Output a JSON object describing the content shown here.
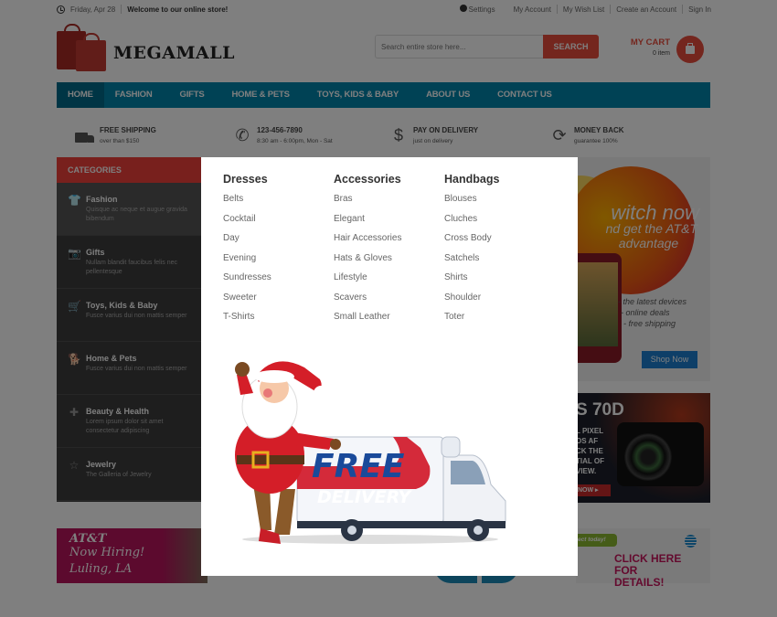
{
  "topbar": {
    "date": "Friday, Apr 28",
    "welcome": "Welcome to our online store!",
    "links": [
      "Settings",
      "My Account",
      "My Wish List",
      "Create an Account",
      "Sign In"
    ]
  },
  "header": {
    "logo_text": "MEGAMALL",
    "search_placeholder": "Search entire store here...",
    "search_button": "SEARCH",
    "cart_label": "MY CART",
    "cart_count": "0 item"
  },
  "nav": {
    "items": [
      "HOME",
      "FASHION",
      "GIFTS",
      "HOME & PETS",
      "TOYS, KIDS & BABY",
      "ABOUT US",
      "CONTACT US"
    ],
    "active": "HOME"
  },
  "features": [
    {
      "icon": "truck-icon",
      "title": "FREE SHIPPING",
      "subtitle": "over than $150"
    },
    {
      "icon": "phone-icon",
      "title": "123-456-7890",
      "subtitle": "8:30 am - 6:00pm, Mon - Sat"
    },
    {
      "icon": "dollar-icon",
      "title": "PAY ON DELIVERY",
      "subtitle": "just on delivery"
    },
    {
      "icon": "refresh-icon",
      "title": "MONEY BACK",
      "subtitle": "guarantee 100%"
    }
  ],
  "categories": {
    "title": "CATEGORIES",
    "items": [
      {
        "icon": "tshirt-icon",
        "glyph": "👕",
        "name": "Fashion",
        "desc": "Quisque ac neque et augue gravida bibendum"
      },
      {
        "icon": "camera-icon",
        "glyph": "📷",
        "name": "Gifts",
        "desc": "Nullam blandit faucibus felis nec pellentesque"
      },
      {
        "icon": "stroller-icon",
        "glyph": "🛒",
        "name": "Toys, Kids & Baby",
        "desc": "Fusce varius dui non mattis semper"
      },
      {
        "icon": "dog-icon",
        "glyph": "🐕",
        "name": "Home & Pets",
        "desc": "Fusce varius dui non mattis semper"
      },
      {
        "icon": "medkit-icon",
        "glyph": "✚",
        "name": "Beauty & Health",
        "desc": "Lorem ipsum dolor sit amet consectetur adipiscing"
      },
      {
        "icon": "star-icon",
        "glyph": "☆",
        "name": "Jewelry",
        "desc": "The Galleria of Jewelry"
      }
    ]
  },
  "mega_menu": {
    "columns": [
      {
        "heading": "Dresses",
        "links": [
          "Belts",
          "Cocktail",
          "Day",
          "Evening",
          "Sundresses",
          "Sweeter",
          "T-Shirts"
        ]
      },
      {
        "heading": "Accessories",
        "links": [
          "Bras",
          "Elegant",
          "Hair Accessories",
          "Hats & Gloves",
          "Lifestyle",
          "Scavers",
          "Small Leather"
        ]
      },
      {
        "heading": "Handbags",
        "links": [
          "Blouses",
          "Cluches",
          "Cross Body",
          "Satchels",
          "Shirts",
          "Shoulder",
          "Toter"
        ]
      }
    ],
    "promo": {
      "line1": "FREE",
      "line2": "DELIVERY"
    }
  },
  "banners": {
    "att": {
      "line1": "witch now",
      "line2": "nd get the AT&T",
      "line3": "advantage",
      "bullets": [
        "- the latest devices",
        "- online deals",
        "- free shipping"
      ],
      "button": "Shop Now"
    },
    "canon": {
      "model": "S 70D",
      "lines": [
        "L PIXEL",
        "OS AF",
        "CK THE",
        "TIAL OF",
        "VIEW."
      ],
      "button": "NOW ▸"
    },
    "ad_left": {
      "line1": "AT&T",
      "line2": "Now Hiring!",
      "line3": "Luling, LA"
    },
    "ad_right": {
      "bubble": "ect today!",
      "cta": "CLICK HERE FOR DETAILS!"
    }
  },
  "colors": {
    "nav": "#0085ab",
    "accent": "#e84c3d",
    "categories_head": "#f0413a",
    "sidebar": "#3d3d3d"
  }
}
